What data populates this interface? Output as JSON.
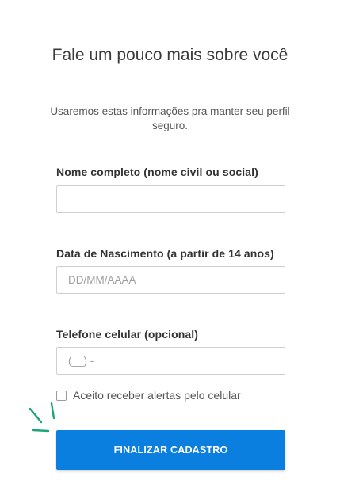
{
  "header": {
    "title": "Fale um pouco mais sobre você",
    "subtitle": "Usaremos estas informações pra manter seu perfil seguro."
  },
  "form": {
    "full_name": {
      "label": "Nome completo (nome civil ou social)",
      "value": "",
      "placeholder": ""
    },
    "birth_date": {
      "label": "Data de Nascimento (a partir de 14 anos)",
      "value": "",
      "placeholder": "DD/MM/AAAA"
    },
    "phone": {
      "label": "Telefone celular (opcional)",
      "value": "",
      "placeholder": "(__) -"
    },
    "alerts_checkbox": {
      "label": "Aceito receber alertas pelo celular",
      "checked": false
    },
    "submit_label": "FINALIZAR CADASTRO"
  },
  "colors": {
    "accent": "#0a7fe0",
    "sparkle": "#1fa37a"
  },
  "icons": {
    "sparkle": "sparkle-icon"
  }
}
